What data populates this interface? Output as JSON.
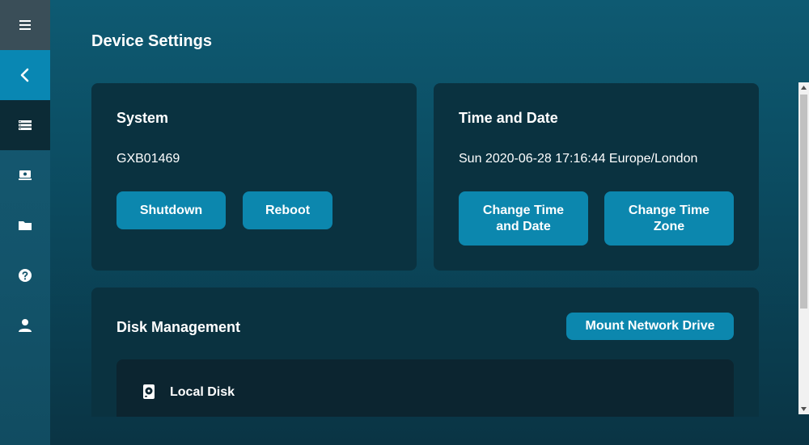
{
  "page": {
    "title": "Device Settings"
  },
  "sidebar": {
    "items": [
      {
        "icon": "menu-icon"
      },
      {
        "icon": "chevron-left-icon"
      },
      {
        "icon": "list-icon"
      },
      {
        "icon": "drive-icon"
      },
      {
        "icon": "folder-icon"
      },
      {
        "icon": "help-icon"
      },
      {
        "icon": "user-icon"
      }
    ],
    "active_item": "list-icon"
  },
  "system": {
    "title": "System",
    "device_name": "GXB01469",
    "shutdown_label": "Shutdown",
    "reboot_label": "Reboot"
  },
  "time_date": {
    "title": "Time and Date",
    "current": "Sun 2020-06-28 17:16:44 Europe/London",
    "change_time_label": "Change Time and Date",
    "change_zone_label": "Change Time Zone"
  },
  "disk": {
    "title": "Disk Management",
    "mount_label": "Mount Network Drive",
    "local_disk_label": "Local Disk"
  },
  "colors": {
    "accent": "#0c87ae",
    "card_bg": "#0a3240",
    "sidebar_active": "#0c2b36",
    "back_button": "#0987b3"
  }
}
